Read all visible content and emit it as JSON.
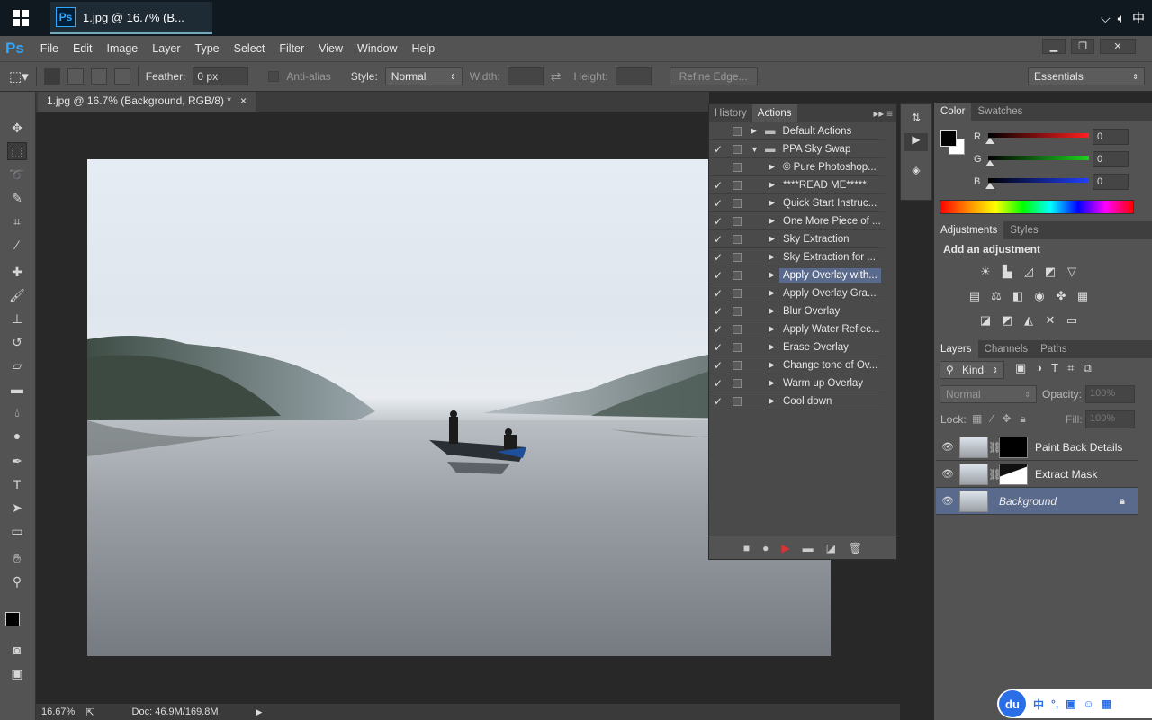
{
  "taskbar": {
    "app_title": "1.jpg @ 16.7% (B...",
    "ime_char": "中"
  },
  "app": {
    "logo": "Ps"
  },
  "menu": [
    "File",
    "Edit",
    "Image",
    "Layer",
    "Type",
    "Select",
    "Filter",
    "View",
    "Window",
    "Help"
  ],
  "options_bar": {
    "feather_label": "Feather:",
    "feather_value": "0 px",
    "antialias_label": "Anti-alias",
    "style_label": "Style:",
    "style_value": "Normal",
    "width_label": "Width:",
    "height_label": "Height:",
    "refine_edge": "Refine Edge...",
    "workspace": "Essentials"
  },
  "document": {
    "tab_title": "1.jpg @ 16.7% (Background, RGB/8) *",
    "close": "×"
  },
  "statusbar": {
    "zoom": "16.67%",
    "doc_info": "Doc: 46.9M/169.8M"
  },
  "actions_panel": {
    "tabs": [
      "History",
      "Actions"
    ],
    "active_tab": "Actions",
    "rows": [
      {
        "label": "Default Actions",
        "checked": false,
        "level": 0,
        "folder": true,
        "expanded": false
      },
      {
        "label": "PPA Sky Swap",
        "checked": true,
        "level": 0,
        "folder": true,
        "expanded": true
      },
      {
        "label": "© Pure Photoshop...",
        "checked": false,
        "level": 1
      },
      {
        "label": "****READ ME*****",
        "checked": true,
        "level": 1
      },
      {
        "label": "Quick Start Instruc...",
        "checked": true,
        "level": 1
      },
      {
        "label": "One More Piece of ...",
        "checked": true,
        "level": 1
      },
      {
        "label": "Sky Extraction",
        "checked": true,
        "level": 1
      },
      {
        "label": "Sky Extraction for ...",
        "checked": true,
        "level": 1
      },
      {
        "label": "Apply Overlay with...",
        "checked": true,
        "level": 1,
        "highlighted": true
      },
      {
        "label": "Apply Overlay Gra...",
        "checked": true,
        "level": 1
      },
      {
        "label": "Blur Overlay",
        "checked": true,
        "level": 1
      },
      {
        "label": "Apply Water Reflec...",
        "checked": true,
        "level": 1
      },
      {
        "label": "Erase Overlay",
        "checked": true,
        "level": 1
      },
      {
        "label": "Change tone of Ov...",
        "checked": true,
        "level": 1
      },
      {
        "label": "Warm up Overlay",
        "checked": true,
        "level": 1
      },
      {
        "label": "Cool down",
        "checked": true,
        "level": 1
      }
    ]
  },
  "color_panel": {
    "tabs": [
      "Color",
      "Swatches"
    ],
    "channels": [
      {
        "label": "R",
        "value": "0",
        "color": "#ff2020"
      },
      {
        "label": "G",
        "value": "0",
        "color": "#20d020"
      },
      {
        "label": "B",
        "value": "0",
        "color": "#2040ff"
      }
    ]
  },
  "adjustments_panel": {
    "tabs": [
      "Adjustments",
      "Styles"
    ],
    "heading": "Add an adjustment"
  },
  "layers_panel": {
    "tabs": [
      "Layers",
      "Channels",
      "Paths"
    ],
    "filter": "Kind",
    "blend_mode": "Normal",
    "opacity_label": "Opacity:",
    "opacity_value": "100%",
    "lock_label": "Lock:",
    "fill_label": "Fill:",
    "fill_value": "100%",
    "layers": [
      {
        "name": "Paint Back Details",
        "mask": "black"
      },
      {
        "name": "Extract Mask",
        "mask": "white-shape"
      },
      {
        "name": "Background",
        "selected": true,
        "locked": true
      }
    ]
  },
  "ime": {
    "logo": "du",
    "char": "中"
  }
}
